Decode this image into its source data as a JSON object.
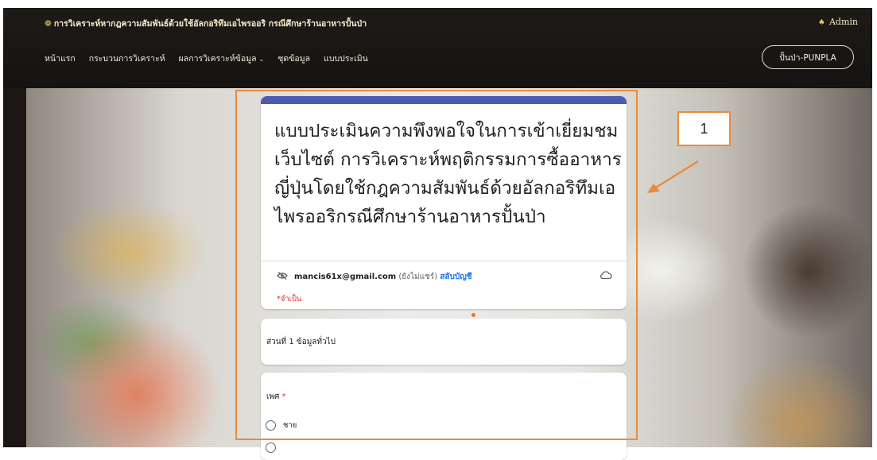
{
  "site": {
    "title": "การวิเคราะห์หากฎความสัมพันธ์ด้วยใช้อัลกอริทึมเอไพรออริ กรณีศึกษาร้านอาหารปั้นป่า",
    "logo_icon": "brand-emblem-icon",
    "user_label": "Admin",
    "user_icon": "person-icon"
  },
  "nav": {
    "items": [
      {
        "label": "หน้าแรก"
      },
      {
        "label": "กระบวนการวิเคราะห์"
      },
      {
        "label": "ผลการวิเคราะห์ข้อมูล",
        "dropdown_icon": "chevron-down-icon"
      },
      {
        "label": "ชุดข้อมูล"
      },
      {
        "label": "แบบประเมิน"
      }
    ],
    "brand_button": "ปั้นป่า-PUNPLA"
  },
  "form": {
    "title": "แบบประเมินความพึงพอใจในการเข้าเยี่ยมชมเว็บไซต์ การวิเคราะห์พฤติกรรมการซื้ออาหารญี่ปุ่นโดยใช้กฎความสัมพันธ์ด้วยอัลกอริทึมเอไพรออริกรณีศึกษาร้านอาหารปั้นป่า",
    "account_email": "mancis61x@gmail.com",
    "account_not_shared": "(ยังไม่แชร์)",
    "switch_account": "สลับบัญชี",
    "required_note": "*จำเป็น",
    "section_title": "ส่วนที่ 1 ข้อมูลทั่วไป",
    "gender_question": "เพศ",
    "gender_required_mark": "*",
    "options": [
      {
        "label": "ชาย"
      },
      {
        "label": ""
      }
    ]
  },
  "annotation": {
    "number": "1",
    "color": "#e98b3d"
  },
  "colors": {
    "form_accent": "#4a5bb0",
    "link_blue": "#1a73e8",
    "required_red": "#d93025"
  }
}
